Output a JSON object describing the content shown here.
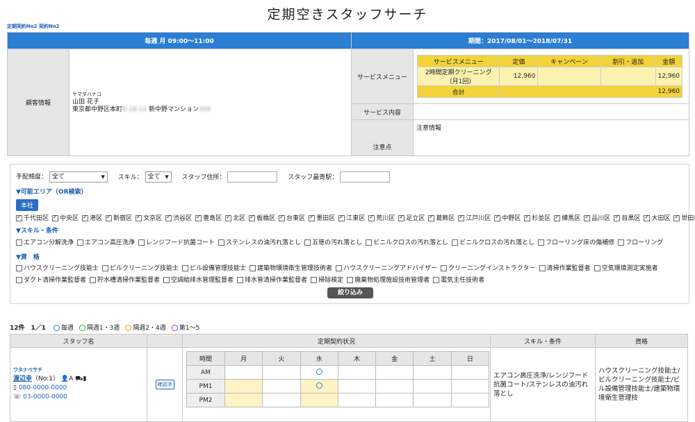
{
  "page": {
    "title": "定期空きスタッフサーチ",
    "contract_link": "定期契約No2 契約No2"
  },
  "contract": {
    "schedule": "毎週 月 09:00～11:00",
    "period": "期間：2017/08/01～2018/07/31",
    "customer_label": "顧客情報",
    "customer_kana": "ヤマダハナコ",
    "customer_name": "山田 花子",
    "customer_address": "東京都中野区本町",
    "customer_address_mid": "6-18-12",
    "customer_building": "新中野マンション",
    "customer_building_room": "309",
    "service_menu_label": "サービスメニュー",
    "service_content_label": "サービス内容",
    "notes_label": "注意点",
    "notes_value": "注意情報",
    "service_table": {
      "headers": [
        "サービスメニュー",
        "定価",
        "キャンペーン",
        "割引・追加",
        "金額"
      ],
      "row": {
        "name": "2時間定期クリーニング（月1回)",
        "price": "12,960",
        "campaign": "",
        "discount": "",
        "amount": "12,960"
      },
      "total_label": "合計",
      "total": "12,960"
    }
  },
  "filter": {
    "freq_label": "手配頻度：",
    "freq_value": "全て",
    "skill_label": "スキル：",
    "skill_value": "全て",
    "address_label": "スタッフ住所：",
    "station_label": "スタッフ最寄駅：",
    "area_title": "▼可能エリア（OR検索）",
    "honsha": "本社",
    "areas": [
      "千代田区",
      "中央区",
      "港区",
      "新宿区",
      "文京区",
      "渋谷区",
      "豊島区",
      "北区",
      "板橋区",
      "台東区",
      "墨田区",
      "江東区",
      "荒川区",
      "足立区",
      "葛飾区",
      "江戸川区",
      "中野区",
      "杉並区",
      "練馬区",
      "品川区",
      "目黒区",
      "大田区",
      "世田谷"
    ],
    "skills_title": "▼スキル・条件",
    "skills": [
      "エアコン分解洗浄",
      "エアコン高圧洗浄",
      "レンジフード抗菌コート",
      "ステンレスの油汚れ落とし",
      "五徳の汚れ落とし",
      "ビニルクロスの汚れ落とし",
      "ビニルクロスの汚れ落とし",
      "フローリング床の傷補修",
      "フローリング"
    ],
    "quals_title": "▼資　格",
    "quals1": [
      "ハウスクリーニング技能士",
      "ビルクリーニング技能士",
      "ビル設備管理技能士",
      "建築物環境衛生管理技術者",
      "ハウスクリーニングアドバイザー",
      "クリーニングインストラクター",
      "清掃作業監督者",
      "空気環境測定実施者"
    ],
    "quals2": [
      "ダクト清掃作業監督者",
      "貯水槽清掃作業監督者",
      "空調給排水管理監督者",
      "排水管清掃作業監督者",
      "掃除検定",
      "廃棄物処理施設技術管理者",
      "電気主任技術者"
    ],
    "submit": "絞り込み"
  },
  "results": {
    "count": "12件",
    "page": "1／1",
    "legend": [
      {
        "label": "毎週",
        "color": "#2b7ed3"
      },
      {
        "label": "隔週1・3週",
        "color": "#2aa84a"
      },
      {
        "label": "隔週2・4週",
        "color": "#e0a100"
      },
      {
        "label": "第1～5",
        "color": "#8a3fc0"
      }
    ],
    "headers": {
      "staff": "スタッフ名",
      "status": "定期契約状況",
      "skills": "スキル・条件",
      "quals": "資格"
    },
    "days": [
      "時間",
      "月",
      "火",
      "水",
      "木",
      "金",
      "土",
      "日"
    ],
    "slots": [
      "AM",
      "PM1",
      "PM2"
    ],
    "staff": {
      "kana": "ワタナベサチ",
      "name": "渡辺幸",
      "no": "（No:1）",
      "rank": "A",
      "phone1": "080-0000-0000",
      "phone2": "03-0000-0000",
      "confirm": "確認済",
      "skills": "エアコン高圧洗浄/レンジフード抗菌コート/ステンレスの油汚れ落とし",
      "quals": "ハウスクリーニング技能士/ビルクリーニング技能士/ビル設備管理技能士/建築物環境衛生管理技"
    }
  }
}
